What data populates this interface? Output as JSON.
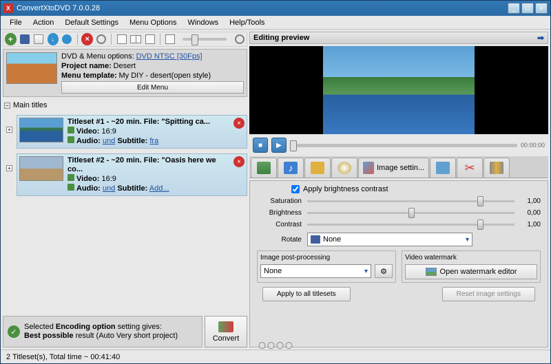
{
  "title": "ConvertXtoDVD 7.0.0.28",
  "menubar": [
    "File",
    "Action",
    "Default Settings",
    "Menu Options",
    "Windows",
    "Help/Tools"
  ],
  "dvdPanel": {
    "optionsLabel": "DVD & Menu options:",
    "optionsLink": "DVD NTSC [30Fps]",
    "projectLabel": "Project name:",
    "projectName": "Desert",
    "templateLabel": "Menu template:",
    "templateName": "My DIY - desert(open style)",
    "editBtn": "Edit Menu"
  },
  "mainTitlesLabel": "Main titles",
  "titlesets": [
    {
      "header": "Titleset #1 - ~20 min. File: \"Spitting ca...",
      "videoLabel": "Video:",
      "videoVal": "16:9",
      "audioLabel": "Audio:",
      "audioVal": "und",
      "subtitleLabel": "Subtitle:",
      "subtitleVal": "fra"
    },
    {
      "header": "Titleset #2 - ~20 min. File: \"Oasis here we co...",
      "videoLabel": "Video:",
      "videoVal": "16:9",
      "audioLabel": "Audio:",
      "audioVal": "und",
      "subtitleLabel": "Subtitle:",
      "subtitleVal": "Add..."
    }
  ],
  "encoding": {
    "line1a": "Selected ",
    "line1b": "Encoding option",
    "line1c": " setting gives:",
    "line2a": "Best possible",
    "line2b": " result (Auto Very short project)"
  },
  "convertBtn": "Convert",
  "preview": {
    "header": "Editing preview",
    "time": "00:00:00"
  },
  "tabs": {
    "active": "Image settin..."
  },
  "settings": {
    "applyBrightness": "Apply brightness contrast",
    "saturationLabel": "Saturation",
    "saturationVal": "1,00",
    "brightnessLabel": "Brightness",
    "brightnessVal": "0,00",
    "contrastLabel": "Contrast",
    "contrastVal": "1,00",
    "rotateLabel": "Rotate",
    "rotateVal": "None",
    "postProcLabel": "Image post-processing",
    "postProcVal": "None",
    "watermarkLabel": "Video watermark",
    "watermarkBtn": "Open watermark editor",
    "applyAllBtn": "Apply to all titlesets",
    "resetBtn": "Reset image settings"
  },
  "statusbar": "2 Titleset(s), Total time ~ 00:41:40"
}
